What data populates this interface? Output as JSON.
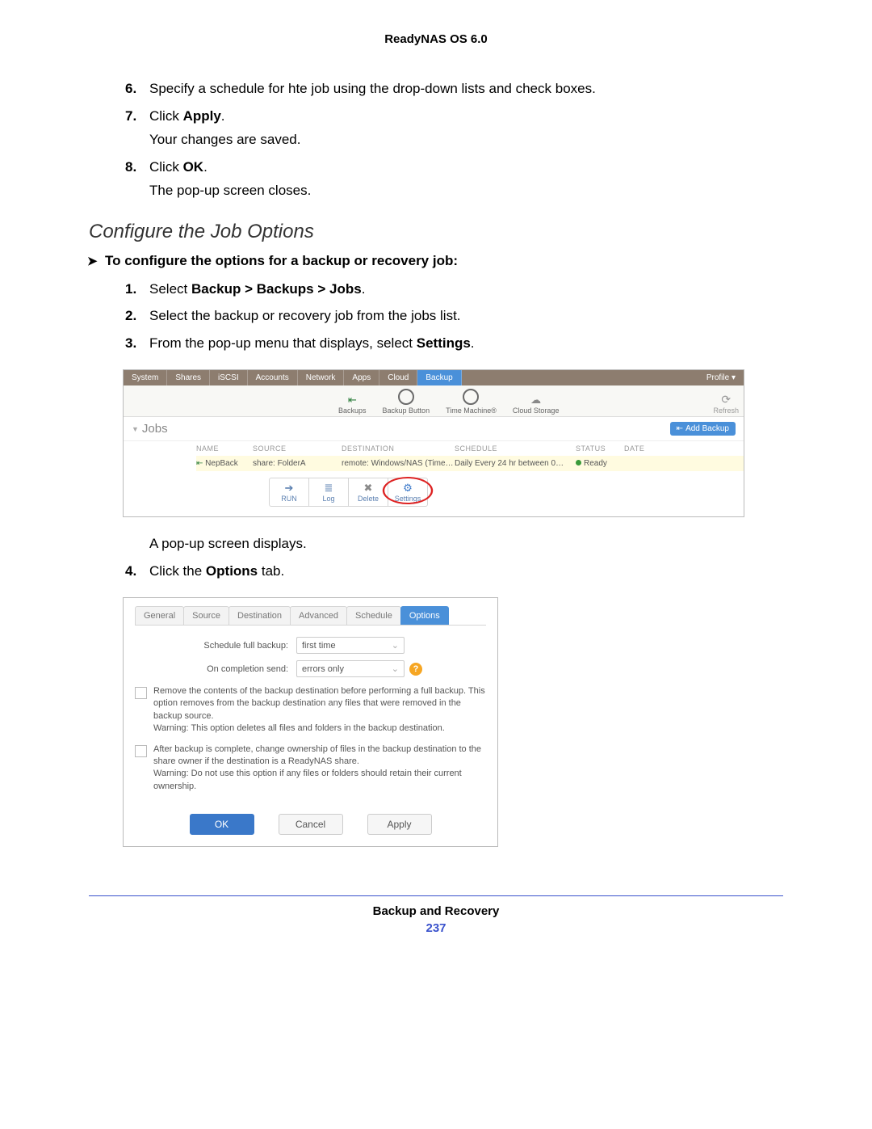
{
  "header": "ReadyNAS OS 6.0",
  "steps_first": [
    {
      "n": "6.",
      "body": "Specify a schedule for hte job using the drop-down lists and check boxes."
    },
    {
      "n": "7.",
      "body_pre": "Click ",
      "body_bold": "Apply",
      "body_post": ".",
      "sub": "Your changes are saved."
    },
    {
      "n": "8.",
      "body_pre": "Click ",
      "body_bold": "OK",
      "body_post": ".",
      "sub": "The pop-up screen closes."
    }
  ],
  "subheading": "Configure the Job Options",
  "task_intro": "To configure the options for a backup or recovery job:",
  "steps_second": [
    {
      "n": "1.",
      "body_pre": "Select ",
      "body_bold": "Backup > Backups > Jobs",
      "body_post": "."
    },
    {
      "n": "2.",
      "body": "Select the backup or recovery job from the jobs list."
    },
    {
      "n": "3.",
      "body_pre": "From the pop-up menu that displays, select ",
      "body_bold": "Settings",
      "body_post": "."
    }
  ],
  "after_shot1": "A pop-up screen displays.",
  "step4": {
    "n": "4.",
    "body_pre": "Click the ",
    "body_bold": "Options",
    "body_post": " tab."
  },
  "shot1": {
    "tabs": [
      "System",
      "Shares",
      "iSCSI",
      "Accounts",
      "Network",
      "Apps",
      "Cloud",
      "Backup"
    ],
    "profile": "Profile ▾",
    "iconbar": {
      "backups": "Backups",
      "backup_button": "Backup Button",
      "time_machine": "Time Machine®",
      "cloud_storage": "Cloud Storage",
      "refresh": "Refresh"
    },
    "jobs_label": "Jobs",
    "add_backup": "Add Backup",
    "columns": {
      "name": "NAME",
      "source": "SOURCE",
      "destination": "DESTINATION",
      "schedule": "SCHEDULE",
      "status": "STATUS",
      "date": "DATE"
    },
    "row": {
      "name": "NepBack",
      "source": "share: FolderA",
      "destination": "remote: Windows/NAS (Time…",
      "schedule": "Daily Every 24 hr between 0…",
      "status": "Ready",
      "date": ""
    },
    "toolbar": {
      "run": "RUN",
      "log": "Log",
      "delete": "Delete",
      "settings": "Settings"
    }
  },
  "shot2": {
    "tabs": [
      "General",
      "Source",
      "Destination",
      "Advanced",
      "Schedule",
      "Options"
    ],
    "field1_label": "Schedule full backup:",
    "field1_value": "first time",
    "field2_label": "On completion send:",
    "field2_value": "errors only",
    "chk1": "Remove the contents of the backup destination before performing a full backup. This option removes from the backup destination any files that were removed in the backup source.\nWarning: This option deletes all files and folders in the backup destination.",
    "chk2": "After backup is complete, change ownership of files in the backup destination to the share owner if the destination is a ReadyNAS share.\nWarning: Do not use this option if any files or folders should retain their current ownership.",
    "buttons": {
      "ok": "OK",
      "cancel": "Cancel",
      "apply": "Apply"
    }
  },
  "footer": {
    "label": "Backup and Recovery",
    "page": "237"
  }
}
